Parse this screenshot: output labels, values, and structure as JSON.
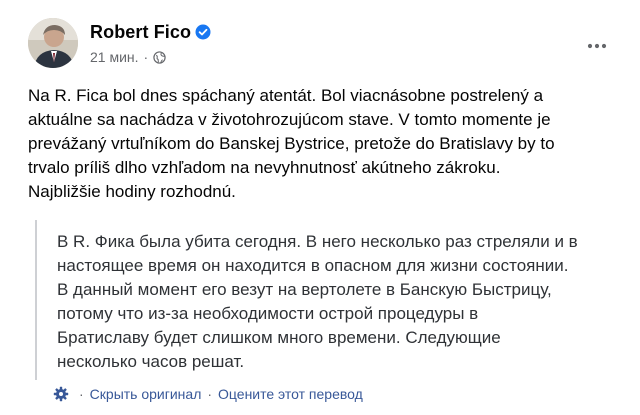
{
  "post": {
    "author": "Robert Fico",
    "time": "21 мин.",
    "meta_separator": "·",
    "text_lines": [
      "Na R. Fica bol dnes spáchaný atentát. Bol viacnásobne postrelený a",
      "aktuálne sa nachádza v životohrozujúcom stave. V tomto momente je",
      "prevážaný vrtuľníkom do Banskej Bystrice, pretože do Bratislavy by to",
      "trvalo príliš dlho vzhľadom na nevyhnutnosť akútneho zákroku.",
      "Najbližšie hodiny rozhodnú."
    ]
  },
  "translation": {
    "lines": [
      "В R. Фика была убита сегодня. В него несколько раз стреляли и в",
      "настоящее время он находится в опасном для жизни состоянии.",
      "В данный момент его везут на вертолете в Банскую Быстрицу,",
      "потому что из-за необходимости острой процедуры в",
      "Братиславу будет слишком много времени. Следующие",
      "несколько часов решат."
    ],
    "hide_original_label": "Скрыть оригинал",
    "separator": "·",
    "rate_label": "Оцените этот перевод"
  },
  "colors": {
    "verified": "#1877f2",
    "link": "#385898",
    "secondary_text": "#65676b"
  },
  "icons": {
    "verified": "verified-badge-icon",
    "audience": "globe-icon",
    "more": "more-options-icon",
    "translation_settings": "gear-icon"
  }
}
